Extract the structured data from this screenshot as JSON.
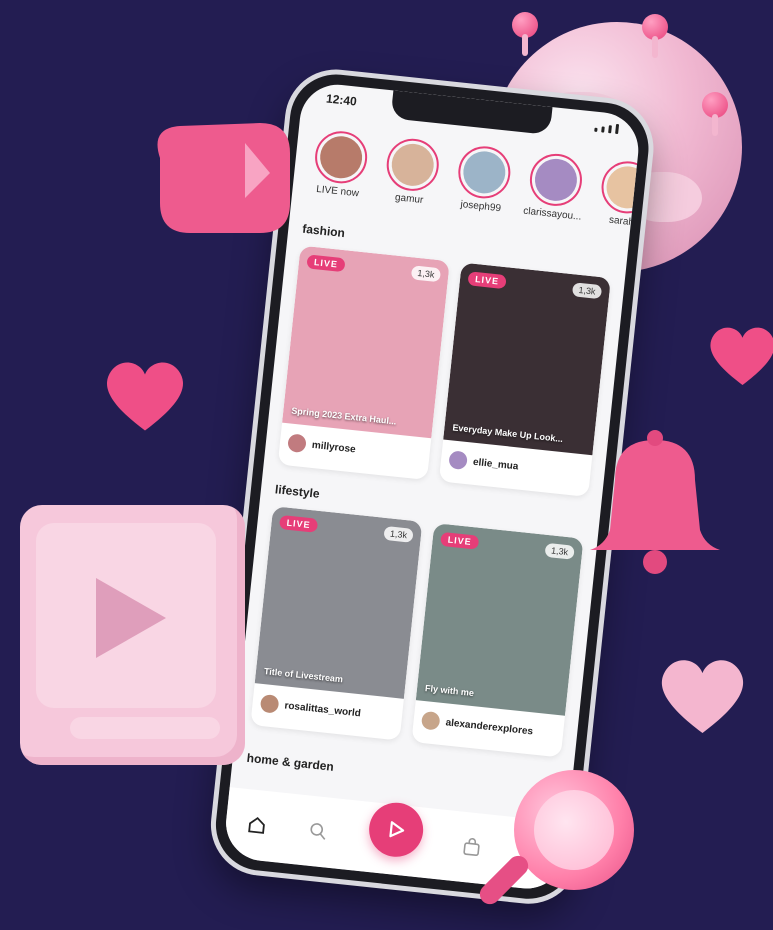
{
  "status": {
    "time": "12:40"
  },
  "stories": [
    {
      "name": "LIVE now",
      "color": "#b77b6a"
    },
    {
      "name": "gamur",
      "color": "#d7b39a"
    },
    {
      "name": "joseph99",
      "color": "#9cb4c8"
    },
    {
      "name": "clarissayou...",
      "color": "#a58bc2"
    },
    {
      "name": "sarahs",
      "color": "#e7c3a1"
    }
  ],
  "sections": {
    "fashion": "fashion",
    "lifestyle": "lifestyle",
    "home": "home & garden"
  },
  "fashion_cards": [
    {
      "live": "LIVE",
      "views": "1,3k",
      "title": "Spring 2023 Extra Haul...",
      "user": "millyrose",
      "bg": "#e7a3b6"
    },
    {
      "live": "LIVE",
      "views": "1,3k",
      "title": "Everyday Make Up Look...",
      "user": "ellie_mua",
      "bg": "#3a2f34"
    }
  ],
  "lifestyle_cards": [
    {
      "live": "LIVE",
      "views": "1,3k",
      "title": "Title of Livestream",
      "user": "rosalittas_world",
      "bg": "#8a8c92"
    },
    {
      "live": "LIVE",
      "views": "1,3k",
      "title": "Fly with me",
      "user": "alexanderexplores",
      "bg": "#7a8b88"
    }
  ],
  "colors": {
    "accent": "#e63e78",
    "background": "#231d52"
  },
  "icons": [
    "home-icon",
    "search-icon",
    "play-icon",
    "bag-icon",
    "avatar"
  ]
}
